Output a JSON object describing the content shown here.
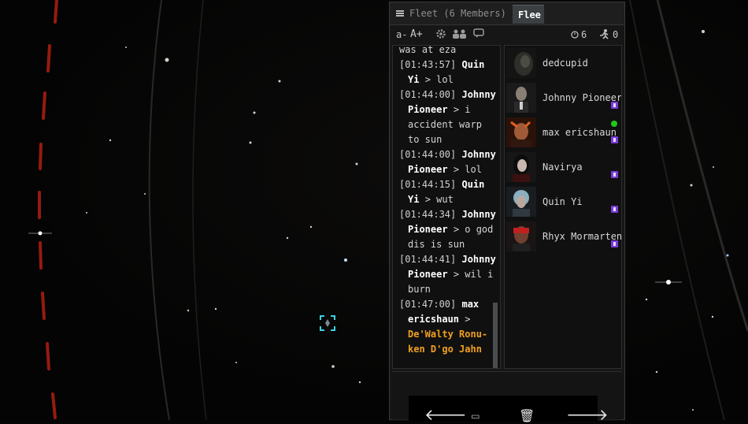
{
  "chat": {
    "channel_title": "Fleet (6 Members) /",
    "active_tab": "Flee",
    "toolbar": {
      "font_smaller": "a-",
      "font_bigger": "A+",
      "timer_count": "6",
      "pilot_count": "0"
    },
    "messages": [
      {
        "timestamp": "",
        "sender": "",
        "text": "was at eza"
      },
      {
        "timestamp": "[01:43:57]",
        "sender": "Quin Yi",
        "text": "> lol"
      },
      {
        "timestamp": "[01:44:00]",
        "sender": "Johnny Pioneer",
        "text": "> i accident warp to sun"
      },
      {
        "timestamp": "[01:44:00]",
        "sender": "Johnny Pioneer",
        "text": "> lol"
      },
      {
        "timestamp": "[01:44:15]",
        "sender": "Quin Yi",
        "text": "> wut"
      },
      {
        "timestamp": "[01:44:34]",
        "sender": "Johnny Pioneer",
        "text": "> o god dis is sun"
      },
      {
        "timestamp": "[01:44:41]",
        "sender": "Johnny Pioneer",
        "text": "> wil i burn"
      },
      {
        "timestamp": "[01:47:00]",
        "sender": "max ericshaun",
        "text": ">",
        "highlight": "De'Walty Ronu-ken  D'go Jahn"
      }
    ],
    "members": [
      {
        "name": "dedcupid",
        "locked": false,
        "online": false
      },
      {
        "name": "Johnny Pioneer",
        "locked": true,
        "online": false
      },
      {
        "name": "max ericshaun",
        "locked": true,
        "online": true
      },
      {
        "name": "Navirya",
        "locked": true,
        "online": false
      },
      {
        "name": "Quin Yi",
        "locked": true,
        "online": false
      },
      {
        "name": "Rhyx Mormartenc",
        "locked": true,
        "online": false
      }
    ],
    "nav": {
      "back": "🡐",
      "save": "▭",
      "delete": "🗑",
      "forward": "🡒"
    }
  },
  "colors": {
    "highlight_text": "#f0a020",
    "lock_badge": "#7a3bd8",
    "online_dot": "#1ec81e",
    "target_bracket": "#3fd0e0"
  }
}
